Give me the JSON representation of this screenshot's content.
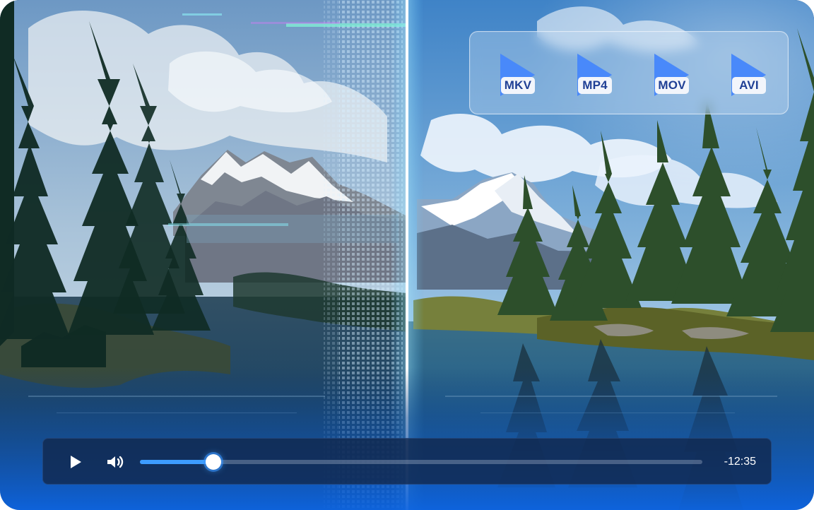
{
  "media": {
    "formats": [
      "MKV",
      "MP4",
      "MOV",
      "AVI"
    ]
  },
  "player": {
    "play_icon": "play-icon",
    "volume_icon": "volume-icon",
    "progress_percent": 13.1,
    "remaining_time": "-12:35"
  },
  "colors": {
    "accent": "#3d9cff",
    "control_bar": "#11284e",
    "panel": "#c6dcf2",
    "format_icon": "#2f6df6"
  }
}
